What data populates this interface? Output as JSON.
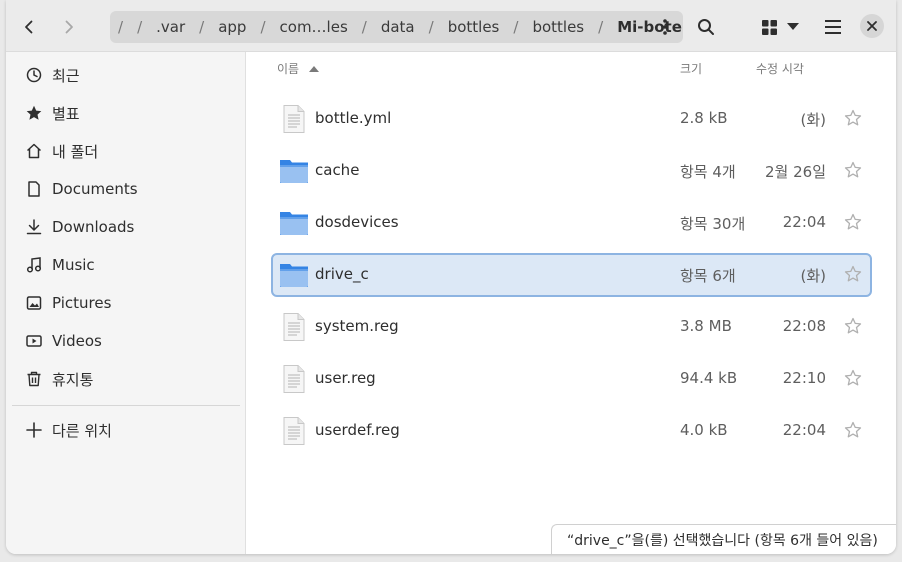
{
  "pathbar": {
    "crumbs": [
      "/",
      ".var",
      "app",
      "com…les",
      "data",
      "bottles",
      "bottles",
      "Mi-botella"
    ]
  },
  "sidebar": {
    "items": [
      {
        "label": "최근",
        "icon": "clock-icon"
      },
      {
        "label": "별표",
        "icon": "star-icon"
      },
      {
        "label": "내 폴더",
        "icon": "home-icon"
      },
      {
        "label": "Documents",
        "icon": "document-icon"
      },
      {
        "label": "Downloads",
        "icon": "download-icon"
      },
      {
        "label": "Music",
        "icon": "music-icon"
      },
      {
        "label": "Pictures",
        "icon": "picture-icon"
      },
      {
        "label": "Videos",
        "icon": "video-icon"
      },
      {
        "label": "휴지통",
        "icon": "trash-icon"
      }
    ],
    "other_locations": "다른 위치"
  },
  "columns": {
    "name": "이름",
    "size": "크기",
    "modified": "수정 시각"
  },
  "files": [
    {
      "name": "bottle.yml",
      "type": "file",
      "size": "2.8 kB",
      "modified": "(화)"
    },
    {
      "name": "cache",
      "type": "folder",
      "size": "항목 4개",
      "modified": "2월 26일"
    },
    {
      "name": "dosdevices",
      "type": "folder",
      "size": "항목 30개",
      "modified": "22:04"
    },
    {
      "name": "drive_c",
      "type": "folder",
      "size": "항목 6개",
      "modified": "(화)",
      "selected": true
    },
    {
      "name": "system.reg",
      "type": "file",
      "size": "3.8 MB",
      "modified": "22:08"
    },
    {
      "name": "user.reg",
      "type": "file",
      "size": "94.4 kB",
      "modified": "22:10"
    },
    {
      "name": "userdef.reg",
      "type": "file",
      "size": "4.0 kB",
      "modified": "22:04"
    }
  ],
  "status": "“drive_c”을(를) 선택했습니다 (항목 6개 들어 있음)",
  "colors": {
    "accent": "#3584e4",
    "folder": "#62a0ea",
    "selection": "#dce8f6"
  }
}
